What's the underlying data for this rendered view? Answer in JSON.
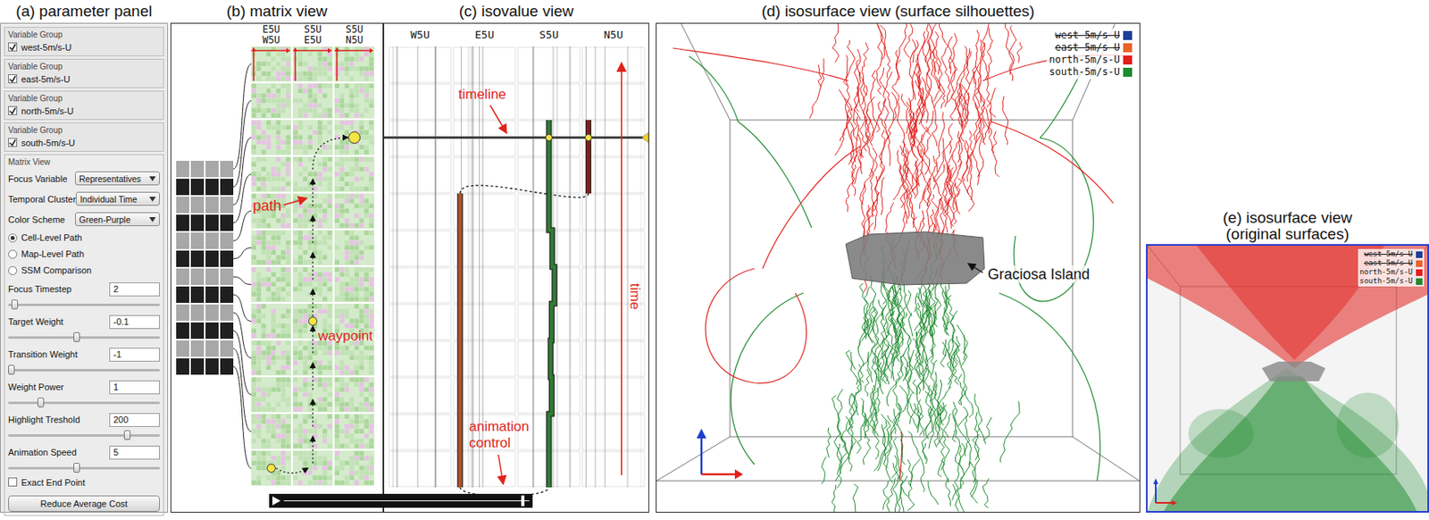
{
  "parameter_panel": {
    "title": "(a) parameter panel",
    "variable_groups": [
      {
        "heading": "Variable Group",
        "label": "west-5m/s-U",
        "checked": true
      },
      {
        "heading": "Variable Group",
        "label": "east-5m/s-U",
        "checked": true
      },
      {
        "heading": "Variable Group",
        "label": "north-5m/s-U",
        "checked": true
      },
      {
        "heading": "Variable Group",
        "label": "south-5m/s-U",
        "checked": true
      }
    ],
    "section": "Matrix View",
    "dropdowns": [
      {
        "label": "Focus Variable",
        "value": "Representatives"
      },
      {
        "label": "Temporal Cluster",
        "value": "Individual Time"
      },
      {
        "label": "Color Scheme",
        "value": "Green-Purple"
      }
    ],
    "radios": [
      {
        "label": "Cell-Level Path",
        "selected": true
      },
      {
        "label": "Map-Level Path",
        "selected": false
      },
      {
        "label": "SSM Comparison",
        "selected": false
      }
    ],
    "fields": [
      {
        "label": "Focus Timestep",
        "value": "2",
        "level": 0.02
      },
      {
        "label": "Target Weight",
        "value": "-0.1",
        "level": 0.45
      },
      {
        "label": "Transition Weight",
        "value": "-1",
        "level": 0.0
      },
      {
        "label": "Weight Power",
        "value": "1",
        "level": 0.2
      },
      {
        "label": "Highlight Treshold",
        "value": "200",
        "level": 0.8
      },
      {
        "label": "Animation Speed",
        "value": "5",
        "level": 0.45
      }
    ],
    "checkbox": {
      "label": "Exact End Point",
      "checked": false
    },
    "button": "Reduce Average Cost"
  },
  "matrix_view": {
    "title": "(b) matrix view",
    "columns": [
      {
        "top": "E5U",
        "bottom": "W5U"
      },
      {
        "top": "S5U",
        "bottom": "E5U"
      },
      {
        "top": "S5U",
        "bottom": "N5U"
      }
    ],
    "clusters": [
      {
        "color": "#a8a8a8"
      },
      {
        "color": "#1f1f1f"
      },
      {
        "color": "#a8a8a8"
      },
      {
        "color": "#1f1f1f"
      },
      {
        "color": "#a8a8a8"
      },
      {
        "color": "#1f1f1f"
      },
      {
        "color": "#a8a8a8"
      },
      {
        "color": "#1f1f1f"
      },
      {
        "color": "#a8a8a8"
      },
      {
        "color": "#1f1f1f"
      },
      {
        "color": "#a8a8a8"
      },
      {
        "color": "#1f1f1f"
      }
    ],
    "path": [
      {
        "col": 0,
        "row": 11,
        "waypoint": true
      },
      {
        "col": 1,
        "row": 11,
        "waypoint": false
      },
      {
        "col": 1,
        "row": 10,
        "waypoint": false
      },
      {
        "col": 1,
        "row": 9,
        "waypoint": false
      },
      {
        "col": 1,
        "row": 8,
        "waypoint": false
      },
      {
        "col": 1,
        "row": 7,
        "waypoint": true
      },
      {
        "col": 1,
        "row": 6,
        "waypoint": false
      },
      {
        "col": 1,
        "row": 5,
        "waypoint": false
      },
      {
        "col": 1,
        "row": 4,
        "waypoint": false
      },
      {
        "col": 1,
        "row": 3,
        "waypoint": false
      },
      {
        "col": 2,
        "row": 2,
        "waypoint": true
      }
    ],
    "path_label": "path",
    "waypoint_label": "waypoint"
  },
  "isovalue_view": {
    "title": "(c) isovalue view",
    "columns": [
      "W5U",
      "E5U",
      "S5U",
      "N5U"
    ],
    "series": [
      {
        "name": "E5U",
        "color": "#b4532a",
        "values": [
          null,
          null,
          null,
          null,
          0.06,
          0.06,
          0.06,
          0.06,
          0.06,
          0.06,
          0.06,
          0.06
        ]
      },
      {
        "name": "S5U",
        "color": "#2f7d32",
        "values": [
          null,
          null,
          0.5,
          0.5,
          0.5,
          0.56,
          0.6,
          0.55,
          0.53,
          0.55,
          0.5,
          0.5
        ]
      },
      {
        "name": "N5U",
        "color": "#8b1a1a",
        "values": [
          null,
          null,
          0.05,
          0.05,
          null,
          null,
          null,
          null,
          null,
          null,
          null,
          null
        ]
      }
    ],
    "timeline": {
      "label": "timeline",
      "row": 2
    },
    "time_label": "time",
    "animation_label_lines": [
      "animation",
      "control"
    ]
  },
  "animation_control": {
    "level": 0.98
  },
  "isosurface_view": {
    "title": "(d) isosurface view (surface silhouettes)",
    "island_label": "Graciosa Island"
  },
  "original_view": {
    "title_lines": [
      "(e) isosurface view",
      "(original surfaces)"
    ]
  },
  "layers": [
    {
      "label": "west-5m/s-U",
      "color": "#1c3f94",
      "visible": false
    },
    {
      "label": "east-5m/s-U",
      "color": "#e8632a",
      "visible": false
    },
    {
      "label": "north-5m/s-U",
      "color": "#e0201c",
      "visible": true
    },
    {
      "label": "south-5m/s-U",
      "color": "#1e8a2e",
      "visible": true
    }
  ]
}
